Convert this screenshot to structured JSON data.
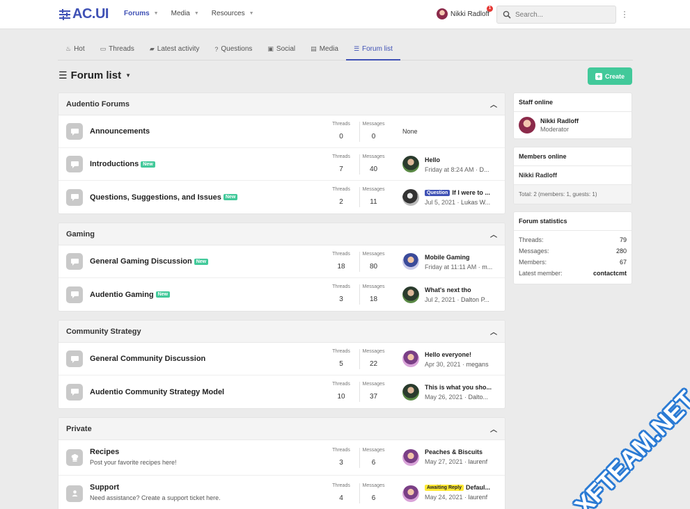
{
  "brand": {
    "logo_text": "AC.UI",
    "accent": "#3f51b5",
    "green": "#42c99a"
  },
  "nav": [
    {
      "label": "Forums",
      "active": true
    },
    {
      "label": "Media",
      "active": false
    },
    {
      "label": "Resources",
      "active": false
    }
  ],
  "user": {
    "name": "Nikki Radloff",
    "alerts": "1"
  },
  "search": {
    "placeholder": "Search..."
  },
  "tabs": [
    {
      "label": "Hot",
      "icon": "fire-icon"
    },
    {
      "label": "Threads",
      "icon": "comment-icon"
    },
    {
      "label": "Latest activity",
      "icon": "comments-icon"
    },
    {
      "label": "Questions",
      "icon": "question-icon"
    },
    {
      "label": "Social",
      "icon": "id-card-icon"
    },
    {
      "label": "Media",
      "icon": "images-icon"
    },
    {
      "label": "Forum list",
      "icon": "list-icon",
      "active": true
    }
  ],
  "page": {
    "title": "Forum list",
    "create_label": "Create"
  },
  "stat_labels": {
    "threads": "Threads",
    "messages": "Messages"
  },
  "categories": [
    {
      "title": "Audentio Forums",
      "forums": [
        {
          "title": "Announcements",
          "new": false,
          "threads": "0",
          "messages": "0",
          "latest_none": "None"
        },
        {
          "title": "Introductions",
          "new": true,
          "new_label": "New",
          "threads": "7",
          "messages": "40",
          "latest_title": "Hello",
          "latest_date": "Friday at 8:24 AM",
          "latest_user": "D..."
        },
        {
          "title": "Questions, Suggestions, and Issues",
          "new": true,
          "new_label": "New",
          "threads": "2",
          "messages": "11",
          "prefix": "Question",
          "latest_title": "If I were to ...",
          "latest_date": "Jul 5, 2021",
          "latest_user": "Lukas W..."
        }
      ]
    },
    {
      "title": "Gaming",
      "forums": [
        {
          "title": "General Gaming Discussion",
          "new": true,
          "new_label": "New",
          "threads": "18",
          "messages": "80",
          "latest_title": "Mobile Gaming",
          "latest_date": "Friday at 11:11 AM",
          "latest_user": "m..."
        },
        {
          "title": "Audentio Gaming",
          "new": true,
          "new_label": "New",
          "threads": "3",
          "messages": "18",
          "latest_title": "What's next tho",
          "latest_date": "Jul 2, 2021",
          "latest_user": "Dalton P..."
        }
      ]
    },
    {
      "title": "Community Strategy",
      "forums": [
        {
          "title": "General Community Discussion",
          "threads": "5",
          "messages": "22",
          "latest_title": "Hello everyone!",
          "latest_date": "Apr 30, 2021",
          "latest_user": "megans"
        },
        {
          "title": "Audentio Community Strategy Model",
          "threads": "10",
          "messages": "37",
          "latest_title": "This is what you sho...",
          "latest_date": "May 26, 2021",
          "latest_user": "Dalto..."
        }
      ]
    },
    {
      "title": "Private",
      "forums": [
        {
          "title": "Recipes",
          "desc": "Post your favorite recipes here!",
          "threads": "3",
          "messages": "6",
          "latest_title": "Peaches & Biscuits",
          "latest_date": "May 27, 2021",
          "latest_user": "laurenf"
        },
        {
          "title": "Support",
          "desc": "Need assistance? Create a support ticket here.",
          "threads": "4",
          "messages": "6",
          "prefix": "Awaiting Reply",
          "latest_title": "Defaul...",
          "latest_date": "May 24, 2021",
          "latest_user": "laurenf"
        }
      ]
    }
  ],
  "sidebar": {
    "staff_title": "Staff online",
    "staff_name": "Nikki Radloff",
    "staff_role": "Moderator",
    "members_title": "Members online",
    "members_name": "Nikki Radloff",
    "members_total": "Total: 2 (members: 1, guests: 1)",
    "stats_title": "Forum statistics",
    "stats": [
      {
        "label": "Threads:",
        "value": "79"
      },
      {
        "label": "Messages:",
        "value": "280"
      },
      {
        "label": "Members:",
        "value": "67"
      },
      {
        "label": "Latest member:",
        "value": "contactcmt"
      }
    ]
  },
  "watermark": "XFTEAM.NET"
}
